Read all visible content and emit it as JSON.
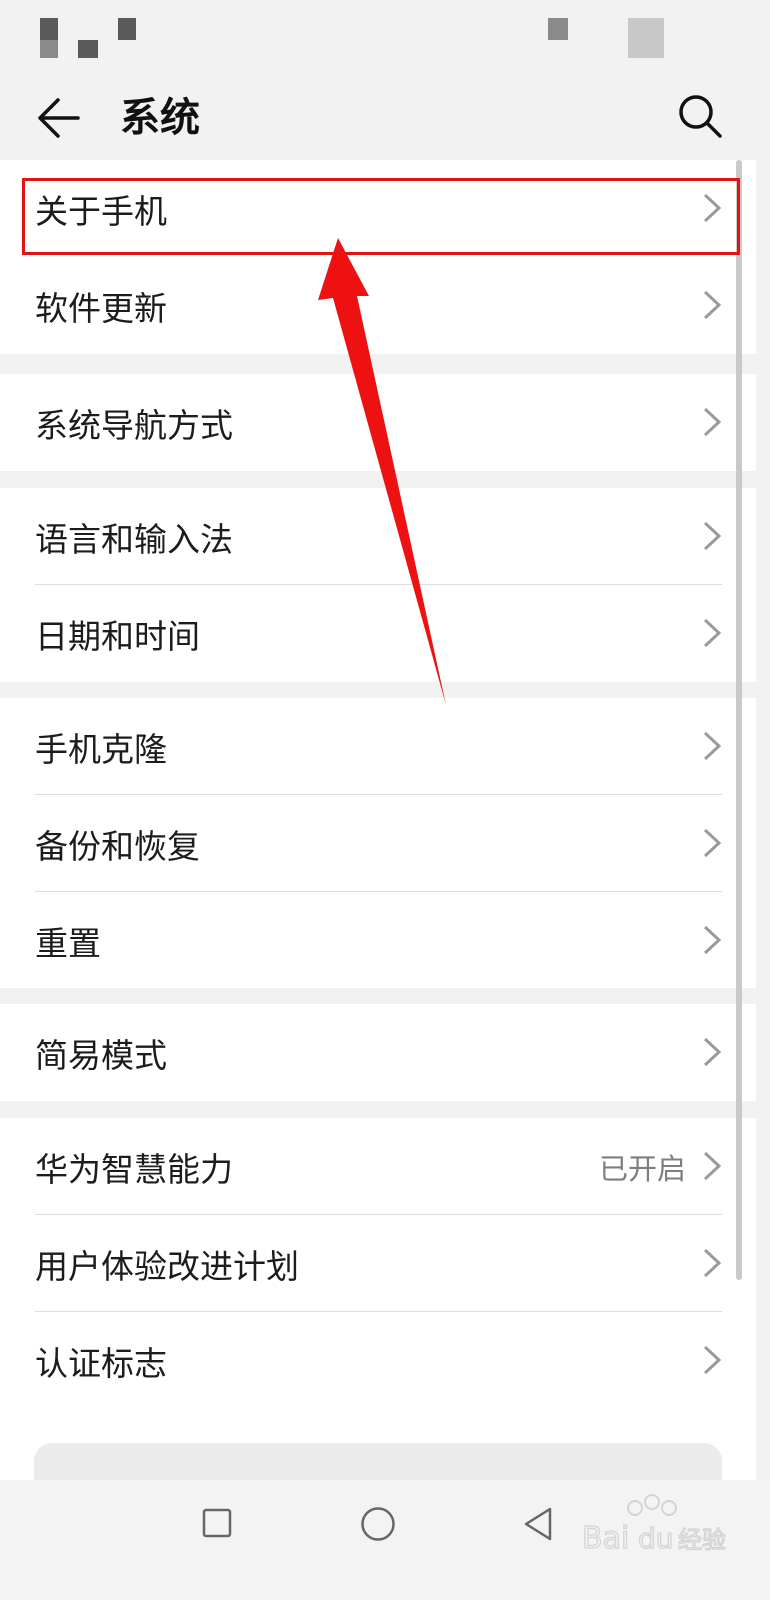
{
  "header": {
    "title": "系统"
  },
  "groups": [
    {
      "items": [
        {
          "label": "关于手机"
        },
        {
          "label": "软件更新"
        }
      ]
    },
    {
      "items": [
        {
          "label": "系统导航方式"
        }
      ]
    },
    {
      "items": [
        {
          "label": "语言和输入法"
        },
        {
          "label": "日期和时间"
        }
      ]
    },
    {
      "items": [
        {
          "label": "手机克隆"
        },
        {
          "label": "备份和恢复"
        },
        {
          "label": "重置"
        }
      ]
    },
    {
      "items": [
        {
          "label": "简易模式"
        }
      ]
    },
    {
      "items": [
        {
          "label": "华为智慧能力",
          "value": "已开启"
        },
        {
          "label": "用户体验改进计划"
        },
        {
          "label": "认证标志"
        }
      ]
    }
  ],
  "colors": {
    "annotation": "#e01414",
    "background": "#f1f1f1",
    "card": "#ffffff"
  },
  "icons": {
    "back": "back-arrow-icon",
    "search": "search-icon",
    "chevron": "chevron-right-icon",
    "nav_recent": "square-icon",
    "nav_home": "circle-icon",
    "nav_back": "triangle-back-icon"
  },
  "watermark": "Baidu经验"
}
